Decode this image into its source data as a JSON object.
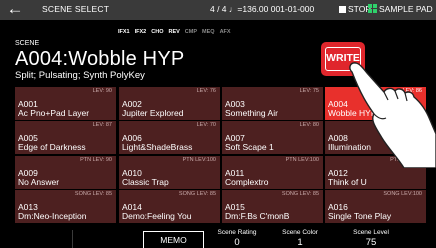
{
  "topbar": {
    "back_glyph": "←",
    "title": "SCENE SELECT",
    "tempo": "4 / 4 ♩=136.00  001-01-000",
    "stop_label": "STOP",
    "pad_label": "SAMPLE PAD"
  },
  "fx": [
    {
      "label": "IFX1",
      "on": true
    },
    {
      "label": "IFX2",
      "on": true
    },
    {
      "label": "CHO",
      "on": true
    },
    {
      "label": "REV",
      "on": true
    },
    {
      "label": "CMP",
      "on": false
    },
    {
      "label": "MEQ",
      "on": false
    },
    {
      "label": "AFX",
      "on": false
    }
  ],
  "scene": {
    "label": "SCENE",
    "name": "A004:Wobble HYP",
    "type": "Split;  Pulsating;  Synth PolyKey"
  },
  "write_label": "WRITE",
  "tiles": [
    {
      "num": "A001",
      "name": "Ac Pno+Pad Layer",
      "lev": "LEV: 90",
      "selected": false
    },
    {
      "num": "A002",
      "name": "Jupiter Explored",
      "lev": "LEV: 76",
      "selected": false
    },
    {
      "num": "A003",
      "name": "Something Air",
      "lev": "LEV: 75",
      "selected": false
    },
    {
      "num": "A004",
      "name": "Wobble HYP",
      "lev": "LEV: 86",
      "selected": true
    },
    {
      "num": "A005",
      "name": "Edge of Darkness",
      "lev": "LEV: 87",
      "selected": false
    },
    {
      "num": "A006",
      "name": "Light&ShadeBrass",
      "lev": "LEV: 70",
      "selected": false
    },
    {
      "num": "A007",
      "name": "Soft Scape 1",
      "lev": "LEV: 80",
      "selected": false
    },
    {
      "num": "A008",
      "name": "Illumination",
      "lev": "LEV: 85",
      "selected": false
    },
    {
      "num": "A009",
      "name": "No Answer",
      "lev": "PTN   LEV: 90",
      "selected": false
    },
    {
      "num": "A010",
      "name": "Classic Trap",
      "lev": "PTN   LEV:100",
      "selected": false
    },
    {
      "num": "A011",
      "name": "Complextro",
      "lev": "PTN   LEV:100",
      "selected": false
    },
    {
      "num": "A012",
      "name": "Think of U",
      "lev": "PTN   LEV: 93",
      "selected": false
    },
    {
      "num": "A013",
      "name": "Dm:Neo-Inception",
      "lev": "SONG   LEV: 85",
      "selected": false
    },
    {
      "num": "A014",
      "name": "Demo:Feeling You",
      "lev": "SONG   LEV: 85",
      "selected": false
    },
    {
      "num": "A015",
      "name": "Dm:F.Bs C'monB",
      "lev": "SONG   LEV: 85",
      "selected": false
    },
    {
      "num": "A016",
      "name": "Single Tone Play",
      "lev": "SONG   LEV:100",
      "selected": false
    }
  ],
  "bottom": {
    "memo_label": "MEMO",
    "rating_label": "Scene Rating",
    "rating_value": "0",
    "color_label": "Scene Color",
    "color_value": "1",
    "level_label": "Scene Level",
    "level_value": "75"
  },
  "colors": {
    "accent": "#e8302c",
    "tile": "#4d2020",
    "bar": "#3a3a3a",
    "pad_icon": "#2fd16b"
  },
  "icons": {
    "back": "back-arrow-icon",
    "stop": "stop-square-icon",
    "pad": "sample-pad-grid-icon",
    "pointer": "pointing-hand-icon"
  }
}
